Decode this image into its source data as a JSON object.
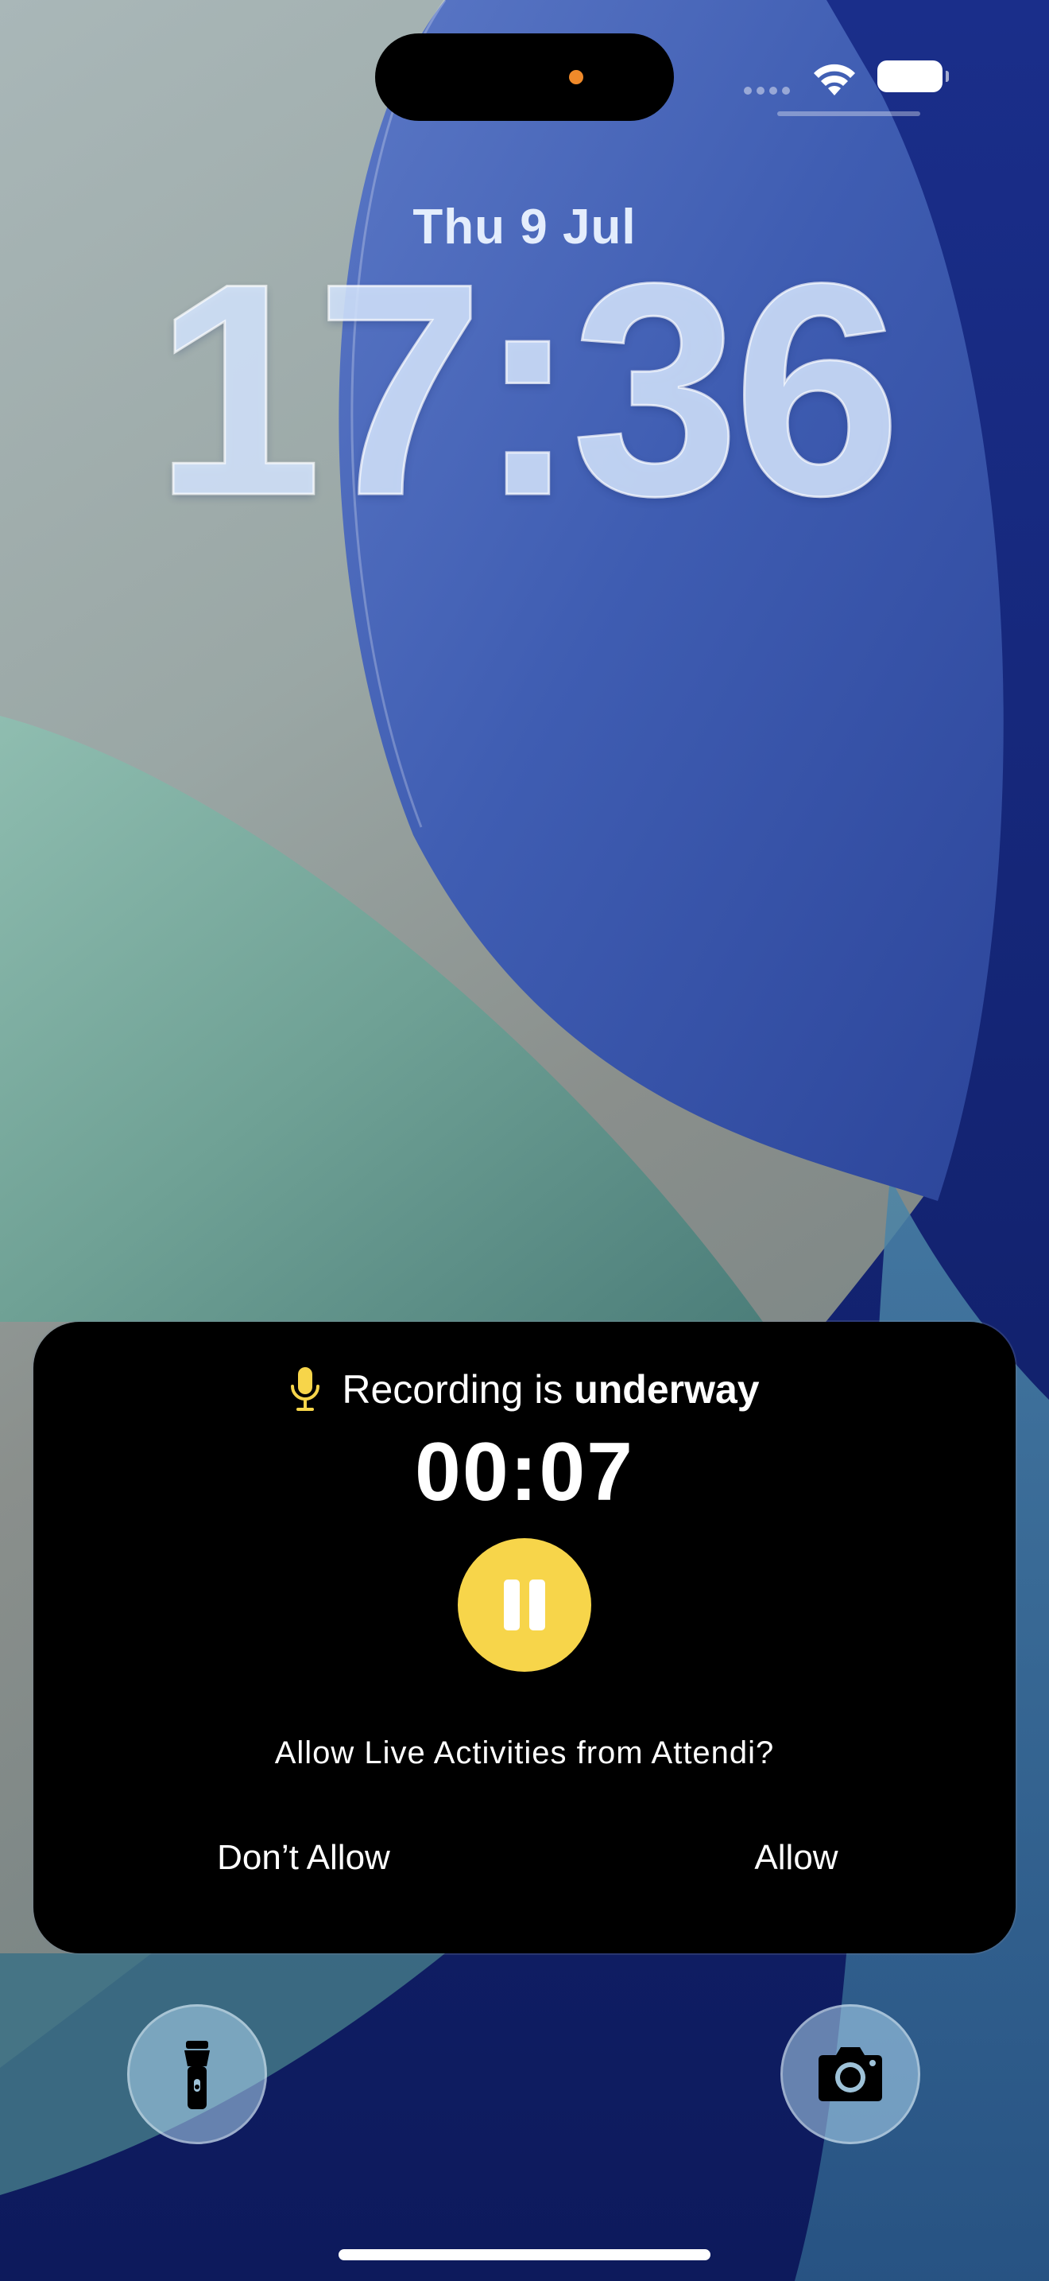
{
  "lock_screen": {
    "date": "Thu 9 Jul",
    "time": "17:36"
  },
  "status_bar": {
    "wifi_icon": "wifi-icon",
    "battery_icon": "battery-icon",
    "cellular_icon": "cellular-dots-icon"
  },
  "live_activity": {
    "title_prefix": "Recording is ",
    "title_emphasis": "underway",
    "timer": "00:07",
    "pause_icon": "pause-icon",
    "mic_icon": "microphone-icon",
    "prompt": "Allow Live Activities from Attendi?",
    "dont_allow_label": "Don’t Allow",
    "allow_label": "Allow",
    "accent_color": "#f7d54a"
  },
  "quick_actions": {
    "left_icon": "flashlight-icon",
    "right_icon": "camera-icon"
  }
}
